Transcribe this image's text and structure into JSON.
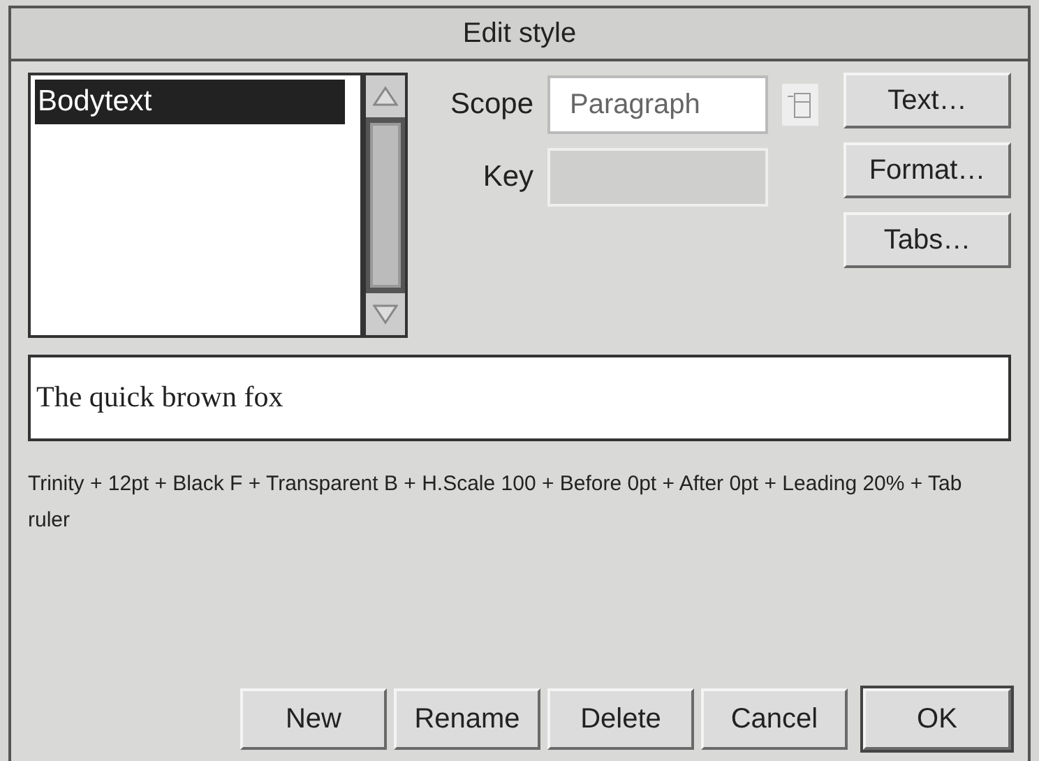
{
  "window": {
    "title": "Edit style"
  },
  "style_list": {
    "items": [
      {
        "label": "Bodytext",
        "selected": true
      }
    ]
  },
  "scope": {
    "label": "Scope",
    "value": "Paragraph"
  },
  "key": {
    "label": "Key",
    "disabled": true
  },
  "side_buttons": [
    "Text…",
    "Format…",
    "Tabs…"
  ],
  "preview": {
    "text": "The quick brown fox"
  },
  "description": "Trinity + 12pt + Black F + Transparent B + H.Scale 100 + Before 0pt + After 0pt + Leading 20% + Tab ruler",
  "buttons": [
    {
      "label": "New",
      "default": false
    },
    {
      "label": "Rename",
      "default": false
    },
    {
      "label": "Delete",
      "default": false
    },
    {
      "label": "Cancel",
      "default": false
    },
    {
      "label": "OK",
      "default": true
    }
  ]
}
